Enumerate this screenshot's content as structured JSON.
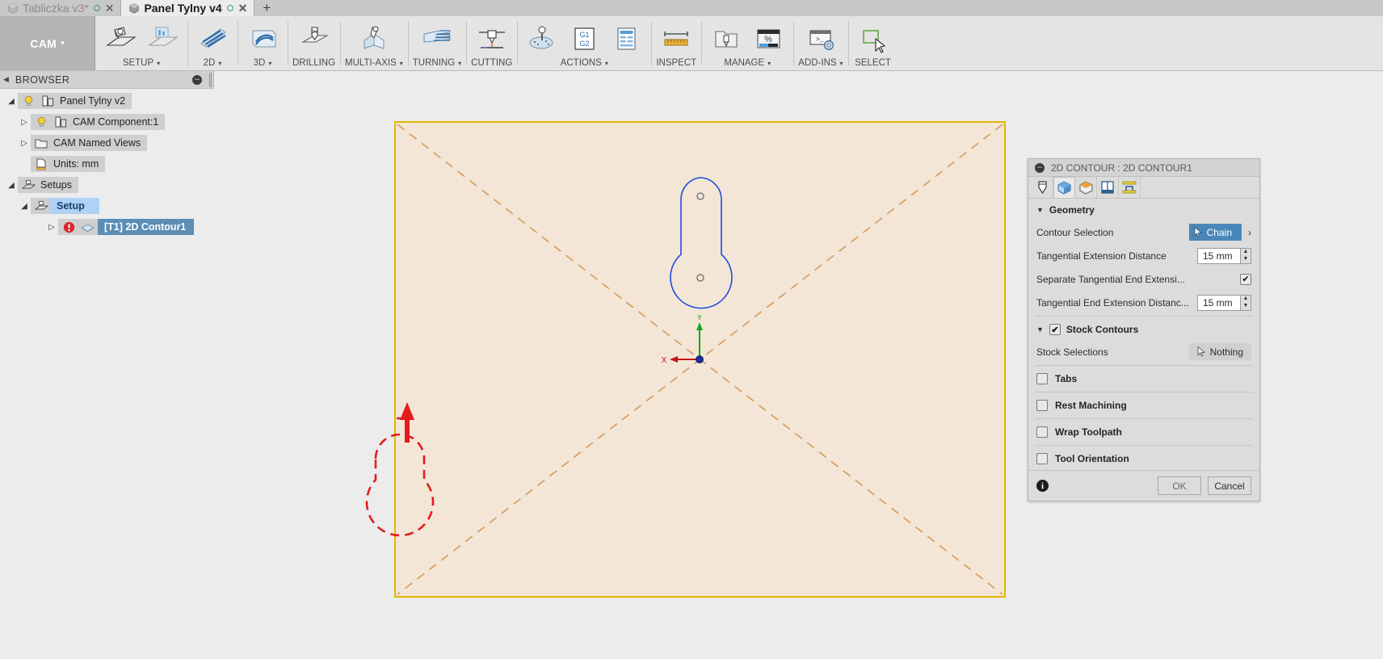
{
  "tabs": [
    {
      "label": "Tabliczka v3*",
      "active": false,
      "close": "✕",
      "dot": "○"
    },
    {
      "label": "Panel Tylny v4",
      "active": true,
      "close": "✕",
      "dot": "○"
    }
  ],
  "tab_new_label": "+",
  "ribbon": {
    "workspace": "CAM",
    "workspace_caret": "▾",
    "groups": [
      {
        "title": "SETUP",
        "caret": "▾",
        "icons": [
          "setup-icon",
          "setup-from-folder-icon"
        ]
      },
      {
        "title": "2D",
        "caret": "▾",
        "icons": [
          "twod-toolpath-icon"
        ]
      },
      {
        "title": "3D",
        "caret": "▾",
        "icons": [
          "threed-toolpath-icon"
        ]
      },
      {
        "title": "DRILLING",
        "caret": "",
        "icons": [
          "drilling-icon"
        ]
      },
      {
        "title": "MULTI-AXIS",
        "caret": "▾",
        "icons": [
          "multi-axis-icon"
        ]
      },
      {
        "title": "TURNING",
        "caret": "▾",
        "icons": [
          "turning-icon"
        ]
      },
      {
        "title": "CUTTING",
        "caret": "",
        "icons": [
          "cutting-icon"
        ]
      },
      {
        "title": "ACTIONS",
        "caret": "▾",
        "icons": [
          "simulate-icon",
          "post-process-icon",
          "setup-sheet-icon"
        ]
      },
      {
        "title": "INSPECT",
        "caret": "",
        "icons": [
          "measure-ruler-icon"
        ]
      },
      {
        "title": "MANAGE",
        "caret": "▾",
        "icons": [
          "tool-library-icon",
          "machining-time-icon"
        ]
      },
      {
        "title": "ADD-INS",
        "caret": "▾",
        "icons": [
          "scripts-addins-icon"
        ]
      },
      {
        "title": "SELECT",
        "caret": "",
        "icons": [
          "select-cursor-icon"
        ]
      }
    ],
    "g1g2_line1": "G1",
    "g1g2_line2": "G2",
    "percent_glyph": "%",
    "prompt_glyph": ">_"
  },
  "browser": {
    "title": "BROWSER",
    "collapse_arrow": "◀",
    "minimize_glyph": "–",
    "tree": [
      {
        "label": "Panel Tylny v2",
        "indent": 0,
        "twisty": "◢",
        "bulb": true,
        "icon": "component-icon",
        "state": "normal"
      },
      {
        "label": "CAM Component:1",
        "indent": 1,
        "twisty": "▷",
        "bulb": true,
        "icon": "component-icon",
        "state": "normal"
      },
      {
        "label": "CAM Named Views",
        "indent": 1,
        "twisty": "▷",
        "bulb": false,
        "icon": "folder-icon",
        "state": "normal"
      },
      {
        "label": "Units: mm",
        "indent": 1,
        "twisty": "",
        "bulb": false,
        "icon": "units-doc-icon",
        "state": "normal"
      },
      {
        "label": "Setups",
        "indent": 0,
        "twisty": "◢",
        "bulb": false,
        "icon": "setup-folder-icon",
        "state": "normal"
      },
      {
        "label": "Setup",
        "indent": 1,
        "twisty": "◢",
        "bulb": false,
        "icon": "setup-folder-icon",
        "state": "selected"
      },
      {
        "label": "[T1] 2D Contour1",
        "indent": 2,
        "twisty": "▷",
        "bulb": false,
        "icon": "toolpath-warning-icon",
        "state": "active"
      }
    ]
  },
  "canvas": {
    "axis_x_label": "X",
    "axis_y_label": "Y",
    "stock_color": "#f3e6d7",
    "stock_border_color": "#e0b700",
    "diagonal_color": "#d79a5b",
    "contour_color": "#1f4fd8",
    "toolpath_color": "#e41b1b"
  },
  "dialog": {
    "title": "2D CONTOUR : 2D CONTOUR1",
    "collapse_glyph": "–",
    "tabs": [
      {
        "name": "tool-tab",
        "active": false
      },
      {
        "name": "geometry-tab",
        "active": true
      },
      {
        "name": "heights-tab",
        "active": false
      },
      {
        "name": "passes-tab",
        "active": false
      },
      {
        "name": "linking-tab",
        "active": false
      }
    ],
    "geometry": {
      "section_label": "Geometry",
      "caret": "▼",
      "contour_selection_label": "Contour Selection",
      "contour_selection_value": "Chain",
      "contour_selection_chevron": "›",
      "tangential_extension_label": "Tangential Extension Distance",
      "tangential_extension_value": "15 mm",
      "separate_tangential_label": "Separate Tangential End Extensi...",
      "separate_tangential_checked": true,
      "tangential_end_label": "Tangential End Extension Distanc...",
      "tangential_end_value": "15 mm"
    },
    "stock_contours": {
      "label": "Stock Contours",
      "caret": "▼",
      "checked": true,
      "stock_selections_label": "Stock Selections",
      "stock_selections_value": "Nothing"
    },
    "options": [
      {
        "label": "Tabs",
        "checked": false
      },
      {
        "label": "Rest Machining",
        "checked": false
      },
      {
        "label": "Wrap Toolpath",
        "checked": false
      },
      {
        "label": "Tool Orientation",
        "checked": false
      }
    ],
    "footer": {
      "info_glyph": "i",
      "ok_label": "OK",
      "cancel_label": "Cancel"
    },
    "check_glyph": "✔"
  }
}
